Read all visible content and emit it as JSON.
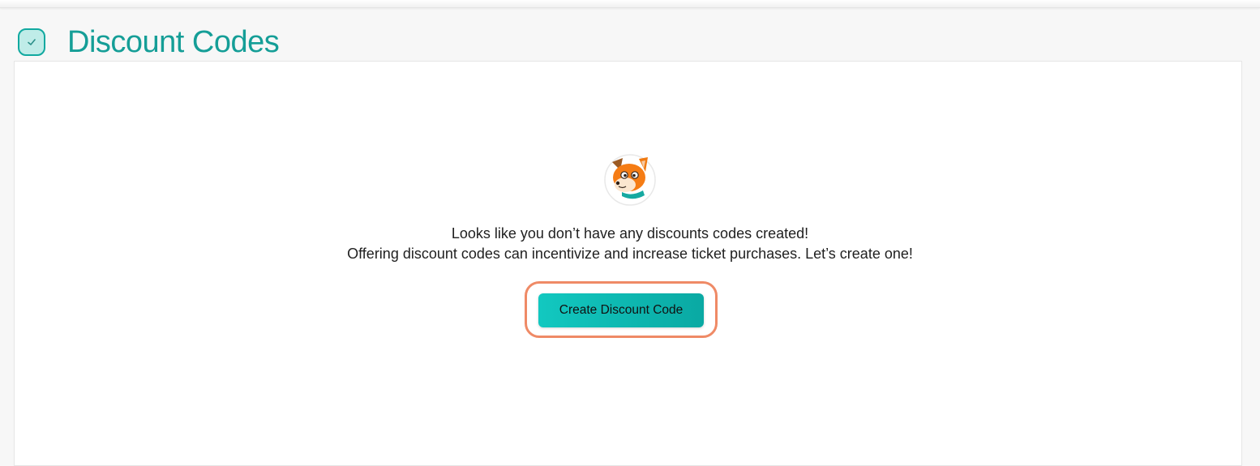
{
  "header": {
    "title": "Discount Codes",
    "icon": "check-icon"
  },
  "empty_state": {
    "mascot": "fox-mascot",
    "line1": "Looks like you don’t have any discounts codes created!",
    "line2": "Offering discount codes can incentivize and increase ticket purchases. Let’s create one!"
  },
  "actions": {
    "create_label": "Create Discount Code"
  },
  "colors": {
    "accent": "#159e97",
    "button": "#12c8c0",
    "highlight": "#ef8a66"
  }
}
